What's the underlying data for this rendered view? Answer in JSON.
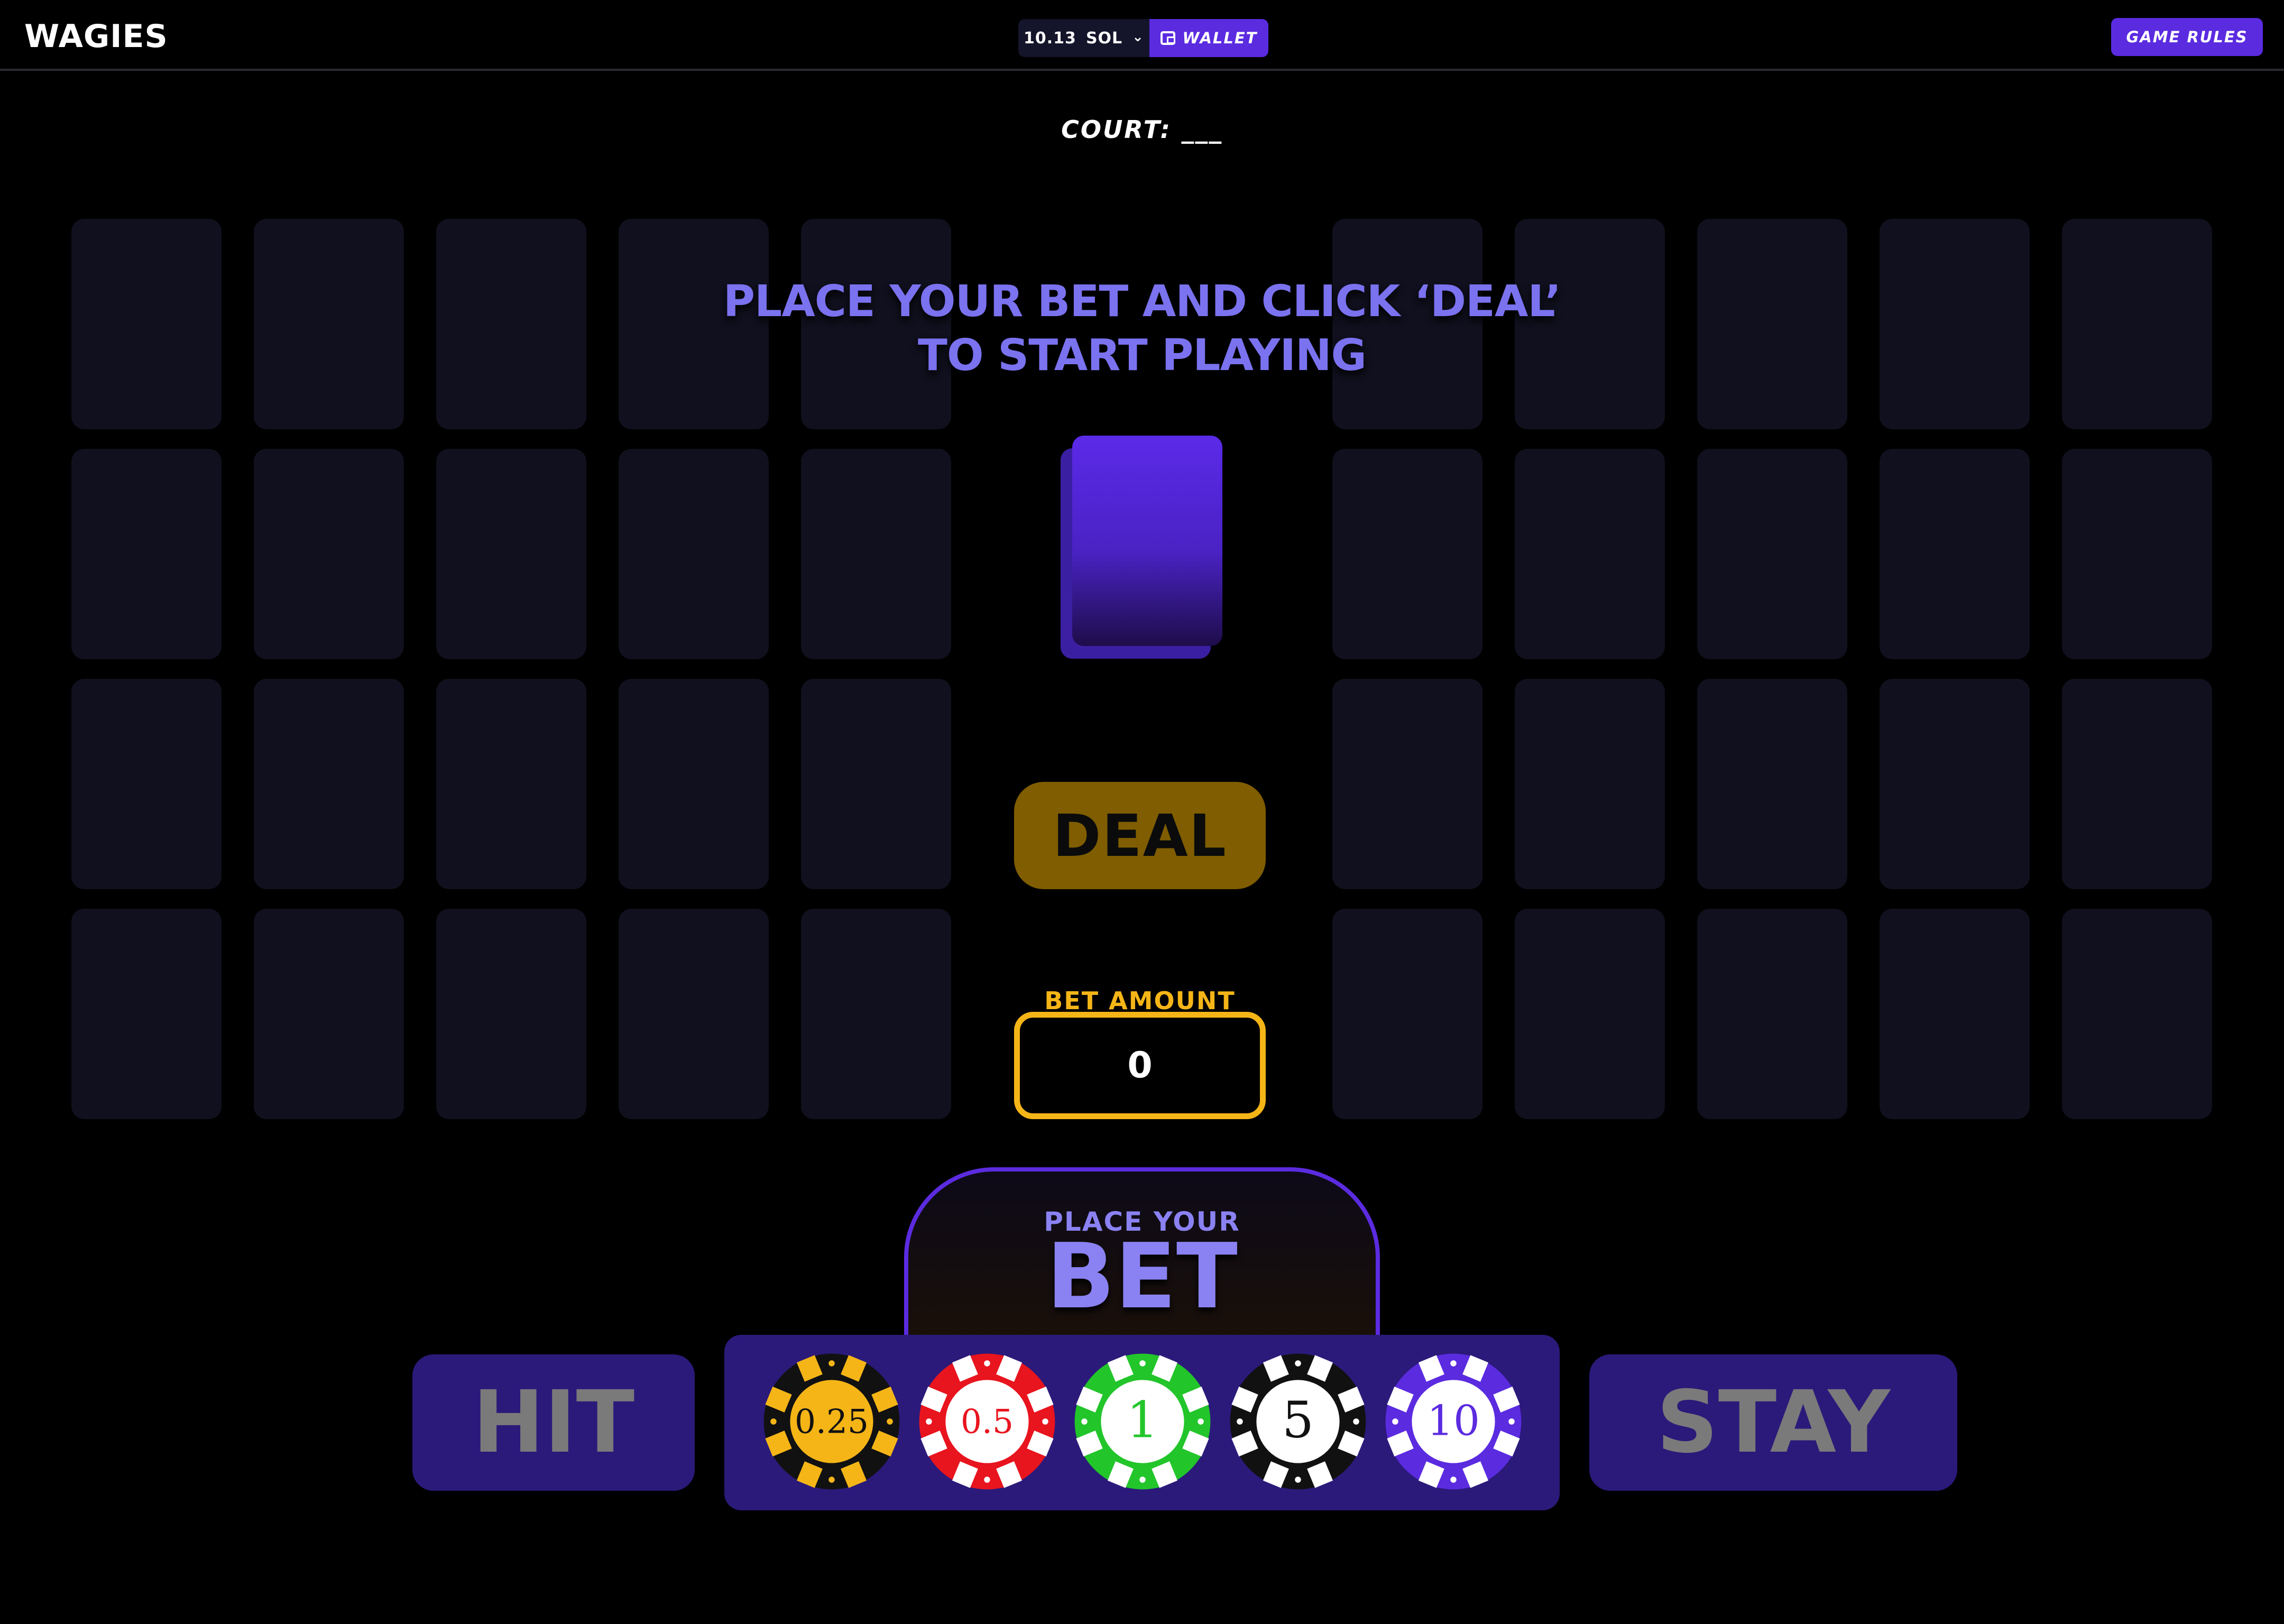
{
  "header": {
    "logo": "WAGIES",
    "balance": "10.13",
    "currency": "SOL",
    "wallet_label": "WALLET",
    "rules_label": "GAME RULES"
  },
  "court": {
    "label": "COURT: ___"
  },
  "message": {
    "line1": "PLACE YOUR BET AND CLICK ‘DEAL’",
    "line2": "TO START PLAYING"
  },
  "deal": {
    "label": "DEAL"
  },
  "bet": {
    "label": "BET AMOUNT",
    "value": "0"
  },
  "place_bet": {
    "small": "PLACE YOUR",
    "big": "BET"
  },
  "actions": {
    "hit": "HIT",
    "stay": "STAY"
  },
  "chips": [
    {
      "value": "0.25",
      "body": "#111111",
      "accent": "#f5b517",
      "center": "#f5b517",
      "text": "#111111"
    },
    {
      "value": "0.5",
      "body": "#e8141e",
      "accent": "#ffffff",
      "center": "#ffffff",
      "text": "#e8141e"
    },
    {
      "value": "1",
      "body": "#22c52a",
      "accent": "#ffffff",
      "center": "#ffffff",
      "text": "#22c52a"
    },
    {
      "value": "5",
      "body": "#111111",
      "accent": "#ffffff",
      "center": "#ffffff",
      "text": "#111111"
    },
    {
      "value": "10",
      "body": "#5b2be0",
      "accent": "#ffffff",
      "center": "#ffffff",
      "text": "#5b2be0"
    }
  ],
  "colors": {
    "accent": "#5b2be0",
    "gold": "#f5b517",
    "slot": "#10101e"
  }
}
